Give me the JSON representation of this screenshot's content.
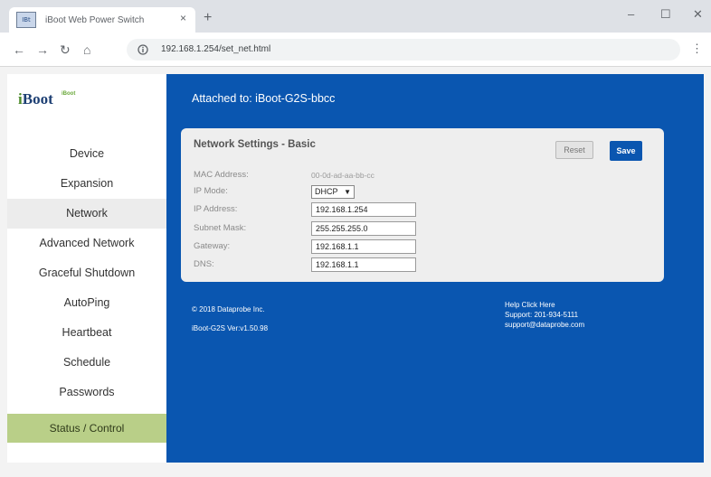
{
  "browser": {
    "tab_title": "iBoot Web Power Switch",
    "tab_close": "×",
    "new_tab": "+",
    "favicon_text": "IBt",
    "minimize": "–",
    "maximize": "☐",
    "close": "✕",
    "back": "←",
    "forward": "→",
    "reload": "↻",
    "home": "⌂",
    "url": "192.168.1.254/set_net.html",
    "menu": "⋮"
  },
  "logo": {
    "text": "iBoot",
    "superscript": "iBoot"
  },
  "sidebar": {
    "items": [
      {
        "label": "Device",
        "active": false
      },
      {
        "label": "Expansion",
        "active": false
      },
      {
        "label": "Network",
        "active": true
      },
      {
        "label": "Advanced Network",
        "active": false
      },
      {
        "label": "Graceful Shutdown",
        "active": false
      },
      {
        "label": "AutoPing",
        "active": false
      },
      {
        "label": "Heartbeat",
        "active": false
      },
      {
        "label": "Schedule",
        "active": false
      },
      {
        "label": "Passwords",
        "active": false
      }
    ],
    "status_button": "Status / Control"
  },
  "header": {
    "attached": "Attached to: iBoot-G2S-bbcc"
  },
  "settings": {
    "title": "Network Settings - Basic",
    "reset_label": "Reset",
    "save_label": "Save",
    "mac_label": "MAC Address:",
    "mac_value": "00-0d-ad-aa-bb-cc",
    "ip_mode_label": "IP Mode:",
    "ip_mode_value": "DHCP",
    "ip_label": "IP Address:",
    "ip_value": "192.168.1.254",
    "subnet_label": "Subnet Mask:",
    "subnet_value": "255.255.255.0",
    "gateway_label": "Gateway:",
    "gateway_value": "192.168.1.1",
    "dns_label": "DNS:",
    "dns_value": "192.168.1.1"
  },
  "footer": {
    "copyright": "© 2018 Dataprobe Inc.",
    "version": "iBoot-G2S Ver:v1.50.98",
    "help": "Help Click Here",
    "support_phone": "Support: 201-934-5111",
    "support_email": "support@dataprobe.com"
  },
  "colors": {
    "content_bg": "#0a56b0",
    "save_button": "#0a56b0",
    "status_button": "#b9cf88",
    "active_item": "#ececec"
  },
  "icons": {
    "favicon": "iboot-favicon-icon",
    "lock": "site-info-icon"
  }
}
